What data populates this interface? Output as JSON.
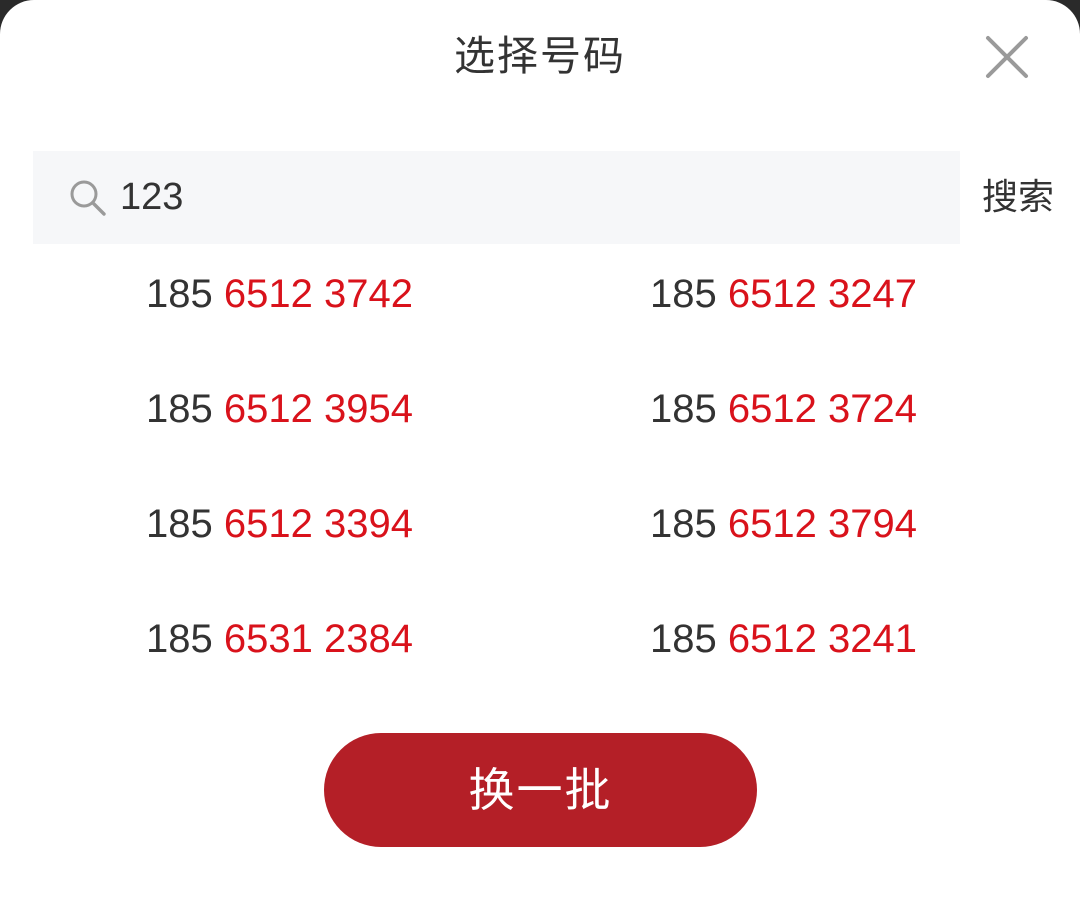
{
  "dialog": {
    "title": "选择号码",
    "close_icon": "close-icon"
  },
  "search": {
    "icon": "search-icon",
    "value": "123",
    "button_label": "搜索"
  },
  "numbers": [
    {
      "prefix": "185 ",
      "suffix": "6512 3742"
    },
    {
      "prefix": "185 ",
      "suffix": "6512 3247"
    },
    {
      "prefix": "185 ",
      "suffix": "6512 3954"
    },
    {
      "prefix": "185 ",
      "suffix": "6512 3724"
    },
    {
      "prefix": "185 ",
      "suffix": "6512 3394"
    },
    {
      "prefix": "185 ",
      "suffix": "6512 3794"
    },
    {
      "prefix": "185 ",
      "suffix": "6531 2384"
    },
    {
      "prefix": "185 ",
      "suffix": "6512 3241"
    }
  ],
  "actions": {
    "refresh_label": "换一批"
  },
  "colors": {
    "accent": "#b41f27",
    "highlight_text": "#d9121b",
    "primary_text": "#333333",
    "search_bg": "#f6f7f9"
  }
}
